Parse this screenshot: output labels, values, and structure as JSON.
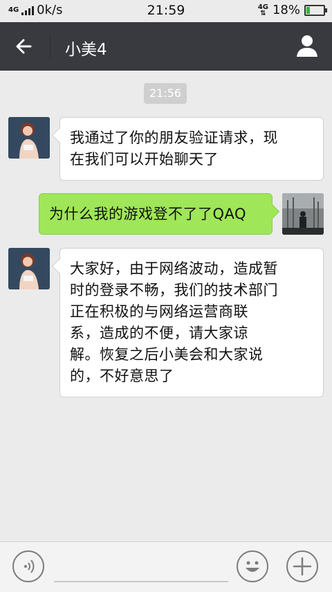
{
  "status_bar": {
    "network_left": "4G",
    "speed": "0k/s",
    "time": "21:59",
    "network_right": "4G",
    "battery": "18%",
    "battery_level": 0.18
  },
  "header": {
    "title": "小美4",
    "back_icon": "arrow-left-icon",
    "profile_icon": "person-icon"
  },
  "chat": {
    "timestamp": "21:56",
    "messages": [
      {
        "sender": "contact",
        "lines": [
          "我通过了你的朋友验证请求，现",
          "在我们可以开始聊天了"
        ]
      },
      {
        "sender": "me",
        "lines": [
          "为什么我的游戏登不了了QAQ"
        ]
      },
      {
        "sender": "contact",
        "lines": [
          "大家好，由于网络波动，造成暂",
          "时的登录不畅，我们的技术部门",
          "正在积极的与网络运营商联",
          "系，造成的不便，请大家谅",
          "解。恢复之后小美会和大家说",
          "的，不好意思了"
        ]
      }
    ]
  },
  "input_bar": {
    "voice_icon": "voice-icon",
    "emoji_icon": "emoji-icon",
    "plus_icon": "plus-icon",
    "input_value": ""
  },
  "colors": {
    "header_bg": "#393a3f",
    "my_bubble": "#9fe658",
    "chat_bg": "#ebebeb"
  }
}
